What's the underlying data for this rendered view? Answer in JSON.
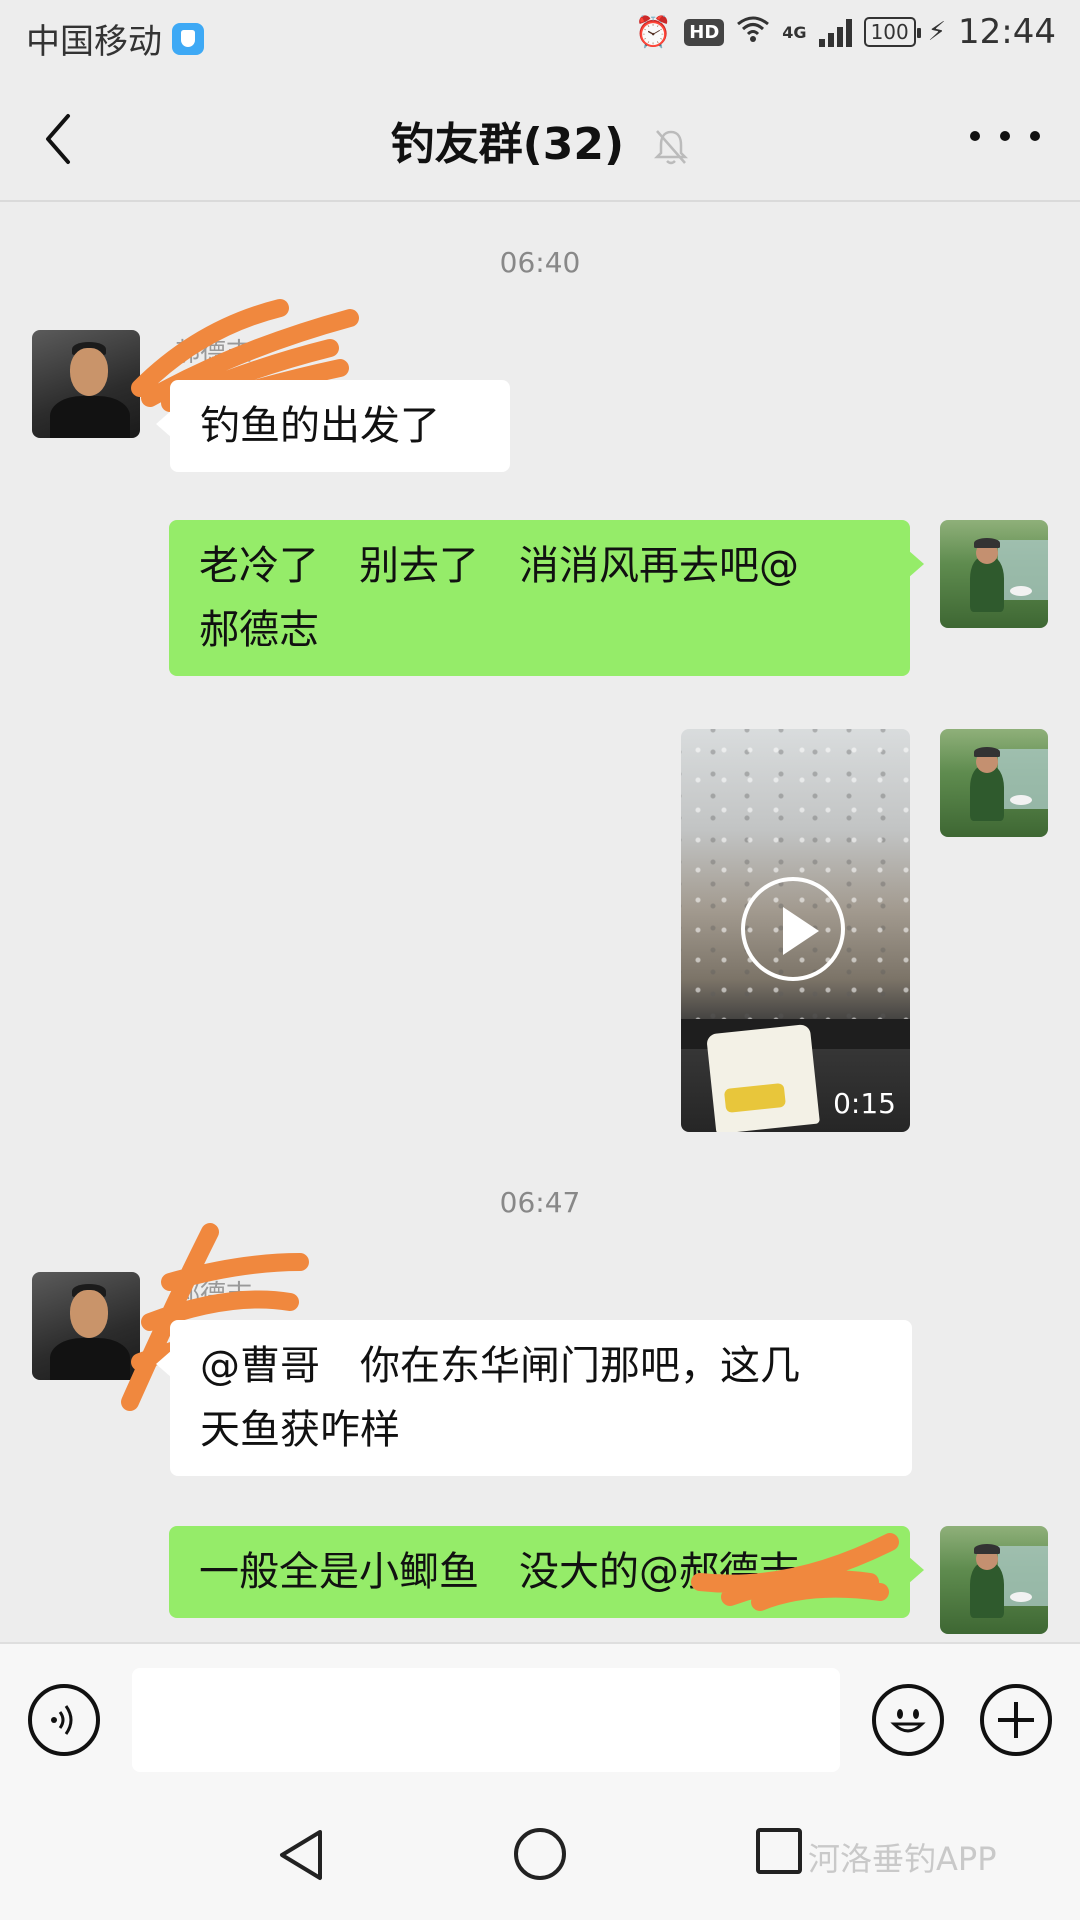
{
  "status_bar": {
    "carrier": "中国移动",
    "network": "4G",
    "hd": "HD",
    "battery": "100",
    "time": "12:44"
  },
  "header": {
    "title": "钓友群(32)"
  },
  "messages": [
    {
      "type": "timestamp",
      "text": "06:40"
    },
    {
      "type": "text",
      "side": "left",
      "sender": "郝德志",
      "text": "钓鱼的出发了"
    },
    {
      "type": "text",
      "side": "right",
      "lines": [
        "老冷了　别去了　消消风再去吧@",
        "郝德志"
      ]
    },
    {
      "type": "video",
      "side": "right",
      "duration": "0:15"
    },
    {
      "type": "timestamp",
      "text": "06:47"
    },
    {
      "type": "text",
      "side": "left",
      "sender": "郝德志",
      "lines": [
        "@曹哥　你在东华闸门那吧，这几",
        "天鱼获咋样"
      ]
    },
    {
      "type": "text",
      "side": "right",
      "text": "一般全是小鲫鱼　没大的@郝德志"
    }
  ],
  "input": {
    "value": ""
  },
  "icons": [
    "back-arrow-icon",
    "mute-bell-icon",
    "more-icon",
    "voice-icon",
    "emoji-icon",
    "plus-icon",
    "play-icon"
  ],
  "watermark": "河洛垂钓APP",
  "colors": {
    "self_bubble": "#95ec69",
    "other_bubble": "#ffffff",
    "background": "#ededed"
  }
}
